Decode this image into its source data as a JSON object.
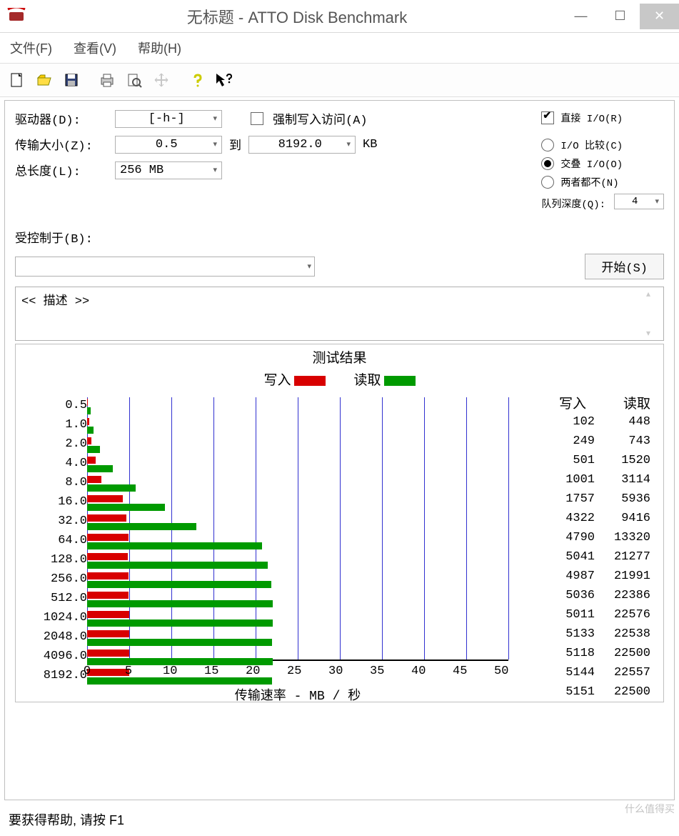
{
  "window": {
    "title": "无标题 - ATTO Disk Benchmark"
  },
  "menu": {
    "file": "文件(F)",
    "view": "查看(V)",
    "help": "帮助(H)"
  },
  "toolbar_icons": [
    "new",
    "open",
    "save",
    "print",
    "preview",
    "move",
    "help",
    "whatsthis"
  ],
  "form": {
    "drive_label": "驱动器(D):",
    "drive_value": "[-h-]",
    "transfer_label": "传输大小(Z):",
    "transfer_from": "0.5",
    "to_label": "到",
    "transfer_to": "8192.0",
    "kb": "KB",
    "length_label": "总长度(L):",
    "length_value": "256 MB",
    "force_write": "强制写入访问(A)",
    "direct_io": "直接 I/O(R)",
    "io_compare": "I/O 比较(C)",
    "overlapped": "交叠 I/O(O)",
    "neither": "两者都不(N)",
    "queue_label": "队列深度(Q):",
    "queue_value": "4",
    "controlled_label": "受控制于(B):",
    "start_btn": "开始(S)",
    "desc_placeholder": "<< 描述 >>"
  },
  "results": {
    "title": "测试结果",
    "legend_write": "写入",
    "legend_read": "读取",
    "col_write": "写入",
    "col_read": "读取",
    "xlabel": "传输速率 - MB / 秒"
  },
  "status": "要获得帮助, 请按 F1",
  "watermark": "什么值得买",
  "chart_data": {
    "type": "bar",
    "xlabel": "传输速率 - MB / 秒",
    "xlim": [
      0,
      50
    ],
    "xticks": [
      0,
      5,
      10,
      15,
      20,
      25,
      30,
      35,
      40,
      45,
      50
    ],
    "categories": [
      "0.5",
      "1.0",
      "2.0",
      "4.0",
      "8.0",
      "16.0",
      "32.0",
      "64.0",
      "128.0",
      "256.0",
      "512.0",
      "1024.0",
      "2048.0",
      "4096.0",
      "8192.0"
    ],
    "series": [
      {
        "name": "写入",
        "unit": "KB/s",
        "values": [
          102,
          249,
          501,
          1001,
          1757,
          4322,
          4790,
          5041,
          4987,
          5036,
          5011,
          5133,
          5118,
          5144,
          5151
        ]
      },
      {
        "name": "读取",
        "unit": "KB/s",
        "values": [
          448,
          743,
          1520,
          3114,
          5936,
          9416,
          13320,
          21277,
          21991,
          22386,
          22576,
          22538,
          22500,
          22557,
          22500
        ]
      }
    ]
  }
}
